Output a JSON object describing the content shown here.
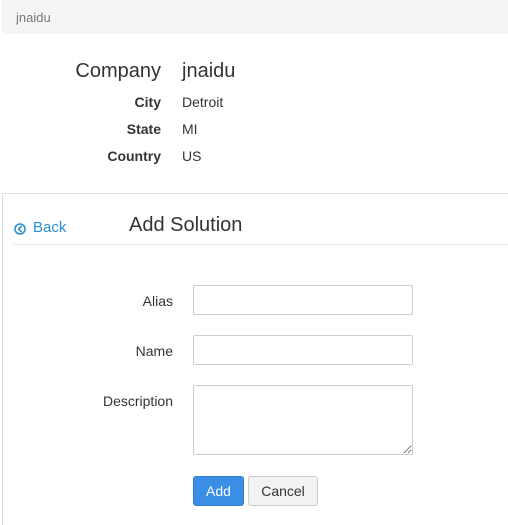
{
  "header": {
    "breadcrumb": "jnaidu"
  },
  "company": {
    "label": "Company",
    "value": "jnaidu",
    "fields": [
      {
        "label": "City",
        "value": "Detroit"
      },
      {
        "label": "State",
        "value": "MI"
      },
      {
        "label": "Country",
        "value": "US"
      }
    ]
  },
  "panel": {
    "back_label": "Back",
    "title": "Add Solution",
    "form": {
      "alias_label": "Alias",
      "alias_value": "",
      "name_label": "Name",
      "name_value": "",
      "description_label": "Description",
      "description_value": "",
      "add_label": "Add",
      "cancel_label": "Cancel"
    }
  },
  "colors": {
    "link": "#2a8fd1",
    "primary_button": "#3a8ee6"
  }
}
